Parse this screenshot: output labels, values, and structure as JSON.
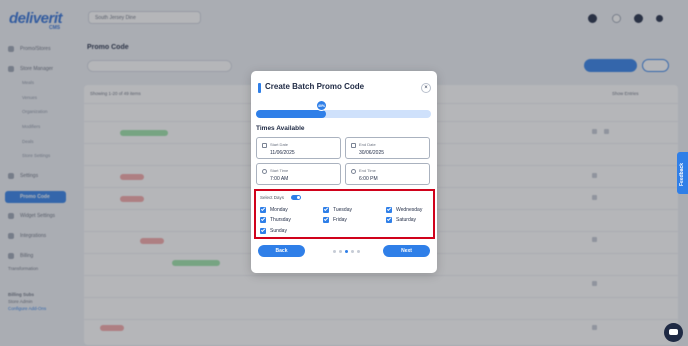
{
  "app": {
    "logo": "deliverit",
    "logo_sub": "CMS",
    "store_select": "South Jersey Dine",
    "page_title": "Promo Code",
    "search_placeholder": "Search Promo Code",
    "showing_text": "Showing 1-20 of 49 items",
    "filter_label": "Show Entries"
  },
  "sidebar": {
    "items": [
      {
        "label": "Promo/Stores"
      },
      {
        "label": "Store Manager"
      },
      {
        "label": "Promo Code"
      },
      {
        "label": "Widget Settings"
      },
      {
        "label": "Integrations"
      },
      {
        "label": "Billing"
      }
    ],
    "subitems": [
      "Meals",
      "Venues",
      "Organization",
      "Modifiers",
      "Deals",
      "Store Settings"
    ],
    "footer": [
      "Billing Subs",
      "Configure Add-Ons",
      "Transformation"
    ],
    "user": "Store Admin"
  },
  "modal": {
    "title": "Create Batch Promo Code",
    "close_symbol": "×",
    "progress": {
      "percent": 40,
      "label": "40%"
    },
    "section_title": "Times Available",
    "start_date": {
      "label": "Start Date",
      "value": "11/06/2025"
    },
    "end_date": {
      "label": "End Date",
      "value": "30/06/2025"
    },
    "start_time": {
      "label": "Start Time",
      "value": "7:00 AM"
    },
    "end_time": {
      "label": "End Time",
      "value": "6:00 PM"
    },
    "select_days_label": "Select Days",
    "days": [
      {
        "label": "Monday",
        "checked": true
      },
      {
        "label": "Tuesday",
        "checked": true
      },
      {
        "label": "Wednesday",
        "checked": true
      },
      {
        "label": "Thursday",
        "checked": true
      },
      {
        "label": "Friday",
        "checked": true
      },
      {
        "label": "Saturday",
        "checked": true
      },
      {
        "label": "Sunday",
        "checked": true
      }
    ],
    "back_label": "Back",
    "next_label": "Next",
    "step_count": 5,
    "current_step": 3
  },
  "feedback_label": "Feedback",
  "colors": {
    "accent": "#2f7fe8",
    "highlight": "#d0021b"
  }
}
